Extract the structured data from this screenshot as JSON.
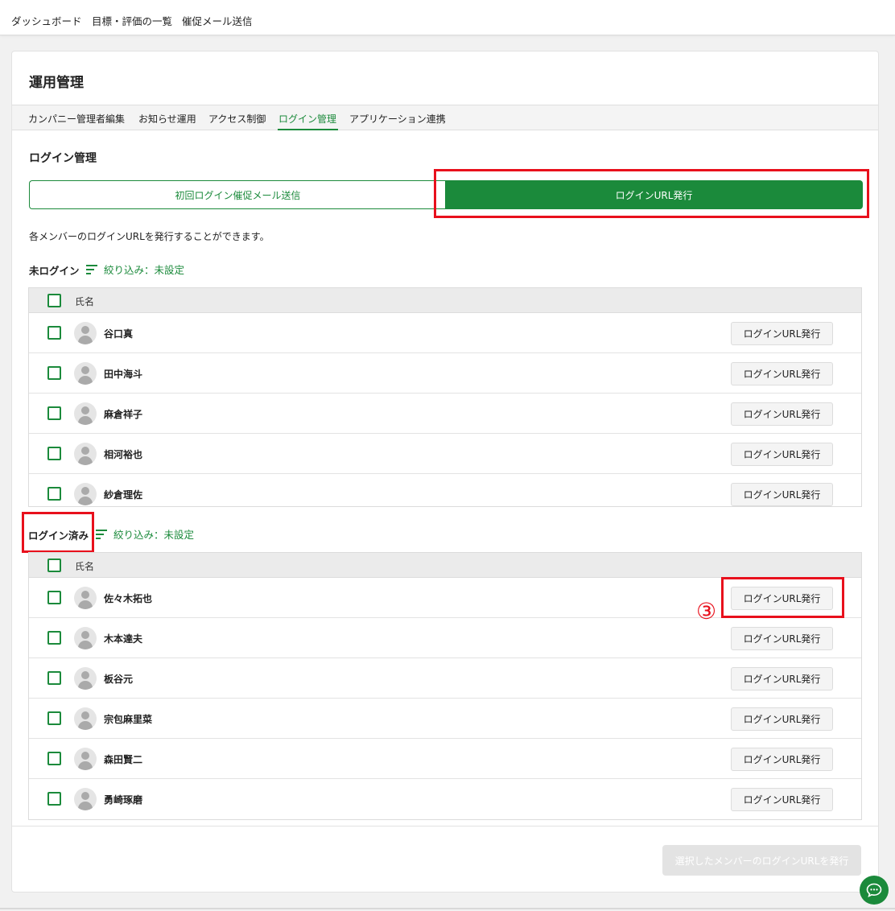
{
  "topnav": {
    "items": [
      "ダッシュボード",
      "目標・評価の一覧",
      "催促メール送信"
    ]
  },
  "page": {
    "title": "運用管理",
    "tabs": [
      "カンパニー管理者編集",
      "お知らせ運用",
      "アクセス制御",
      "ログイン管理",
      "アプリケーション連携"
    ],
    "active_tab": "ログイン管理"
  },
  "section": {
    "title": "ログイン管理",
    "segment_left": "初回ログイン催促メール送信",
    "segment_right": "ログインURL発行",
    "description": "各メンバーのログインURLを発行することができます。"
  },
  "not_logged_in": {
    "label": "未ログイン",
    "filter": "絞り込み：未設定",
    "column_name": "氏名",
    "members": [
      {
        "name": "谷口真",
        "button": "ログインURL発行"
      },
      {
        "name": "田中海斗",
        "button": "ログインURL発行"
      },
      {
        "name": "麻倉祥子",
        "button": "ログインURL発行"
      },
      {
        "name": "相河裕也",
        "button": "ログインURL発行"
      },
      {
        "name": "紗倉理佐",
        "button": "ログインURL発行"
      }
    ]
  },
  "logged_in": {
    "label": "ログイン済み",
    "filter": "絞り込み：未設定",
    "column_name": "氏名",
    "members": [
      {
        "name": "佐々木拓也",
        "button": "ログインURL発行"
      },
      {
        "name": "木本達夫",
        "button": "ログインURL発行"
      },
      {
        "name": "板谷元",
        "button": "ログインURL発行"
      },
      {
        "name": "宗包麻里菜",
        "button": "ログインURL発行"
      },
      {
        "name": "森田賢二",
        "button": "ログインURL発行"
      },
      {
        "name": "勇崎琢磨",
        "button": "ログインURL発行"
      }
    ]
  },
  "footer": {
    "bulk_button": "選択したメンバーのログインURLを発行"
  },
  "annotation": {
    "marker": "③"
  },
  "colors": {
    "accent": "#1b8a3b",
    "highlight": "#e8101c",
    "disabled": "#e3e3e3"
  },
  "icons": {
    "filter": "filter-lines-icon",
    "avatar": "user-avatar-icon",
    "chat": "chat-bubble-icon",
    "checkbox": "checkbox-icon"
  }
}
